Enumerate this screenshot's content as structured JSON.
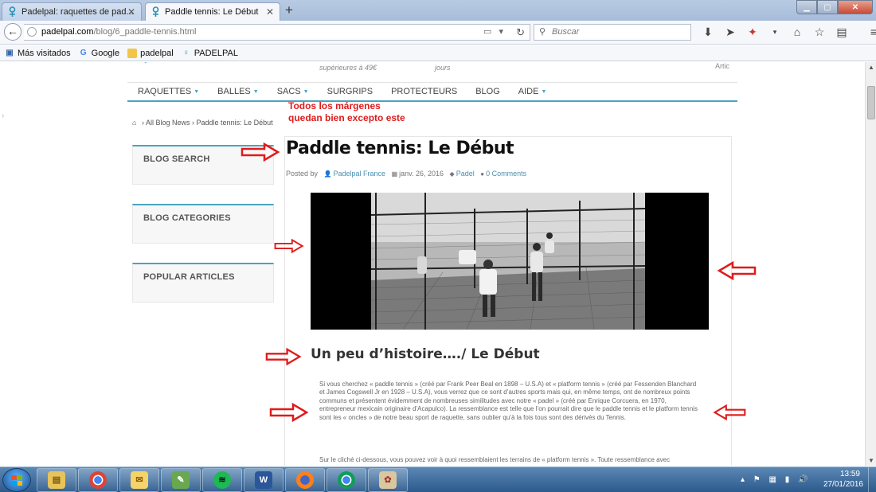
{
  "browser": {
    "tabs": [
      {
        "title": "Padelpal: raquettes de pad...",
        "active": false
      },
      {
        "title": "Paddle tennis: Le Début",
        "active": true
      }
    ],
    "new_tab_label": "+",
    "url_host": "padelpal.com",
    "url_path": "/blog/6_paddle-tennis.html",
    "search_placeholder": "Buscar",
    "bookmarks": [
      {
        "label": "Más visitados",
        "icon": "bookmarks-star-icon"
      },
      {
        "label": "Google",
        "icon": "google-icon"
      },
      {
        "label": "padelpal",
        "icon": "folder-icon"
      },
      {
        "label": "PADELPAL",
        "icon": "padelpal-favicon"
      }
    ]
  },
  "page": {
    "top_strip": {
      "promo1": "supérieures à 49€",
      "promo2": "jours",
      "promo3": "Artic"
    },
    "nav": [
      {
        "label": "RAQUETTES",
        "dropdown": true
      },
      {
        "label": "BALLES",
        "dropdown": true
      },
      {
        "label": "SACS",
        "dropdown": true
      },
      {
        "label": "SURGRIPS",
        "dropdown": false
      },
      {
        "label": "PROTECTEURS",
        "dropdown": false
      },
      {
        "label": "BLOG",
        "dropdown": false
      },
      {
        "label": "AIDE",
        "dropdown": true
      }
    ],
    "breadcrumb": {
      "home_icon": "home-icon",
      "sep": "›",
      "all_blog": "All Blog News",
      "current": "Paddle tennis: Le Début"
    },
    "sidebar": {
      "search_title": "BLOG SEARCH",
      "categories_title": "BLOG CATEGORIES",
      "popular_title": "POPULAR ARTICLES"
    },
    "post": {
      "title": "Paddle tennis: Le Début",
      "posted_by": "Posted by",
      "author": "Padelpal France",
      "date": "janv. 26, 2016",
      "category": "Padel",
      "comments": "0 Comments",
      "heading": "Un peu d’histoire…./ Le Début",
      "paragraph1": "Si vous cherchez « paddle tennis » (créé par Frank Peer Beal en 1898 – U.S.A) et « platform tennis » (créé par Fessenden Blanchard et James Cogswell Jr en 1928 – U.S.A), vous verrez que ce sont d’autres sports mais qui, en même temps, ont de nombreux points communs et présentent évidemment de nombreuses similitudes avec notre « padel » (créé par Enrique Corcuera, en 1970, entrepreneur mexicain originaire d’Acapulco). La ressemblance est telle que l’on pourrait dire que le paddle tennis et le platform tennis sont les « oncles » de notre beau sport de raquette, sans oublier qu’à la fois tous sont des dérivés du Tennis.",
      "paragraph2": "Sur le cliché ci-dessous, vous pouvez voir à quoi ressemblaient les terrains de « platform tennis ». Toute ressemblance avec"
    },
    "annotation": {
      "note": "Todos los márgenes quedan bien excepto este",
      "color": "#e01b1b"
    }
  },
  "taskbar": {
    "time": "13:59",
    "date": "27/01/2016",
    "apps": [
      "explorer-icon",
      "chrome-icon",
      "mail-icon",
      "paint-icon",
      "spotify-icon",
      "word-icon",
      "firefox-icon",
      "chrome-icon",
      "paint-palette-icon"
    ]
  },
  "colors": {
    "accent": "#4aa3bf",
    "annotation": "#e01b1b"
  }
}
